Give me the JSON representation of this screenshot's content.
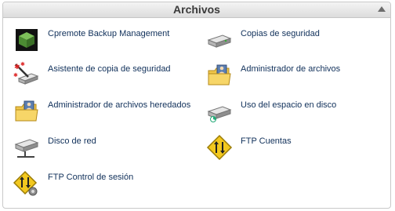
{
  "panel": {
    "title": "Archivos"
  },
  "items": [
    {
      "label": "Cpremote Backup Management",
      "icon": "cpremote-backup-icon"
    },
    {
      "label": "Copias de seguridad",
      "icon": "backup-drive-icon"
    },
    {
      "label": "Asistente de copia de seguridad",
      "icon": "backup-wizard-icon"
    },
    {
      "label": "Administrador de archivos",
      "icon": "file-manager-folder-icon"
    },
    {
      "label": "Administrador de archivos heredados",
      "icon": "legacy-file-manager-folder-icon"
    },
    {
      "label": "Uso del espacio en disco",
      "icon": "disk-usage-icon"
    },
    {
      "label": "Disco de red",
      "icon": "network-disk-icon"
    },
    {
      "label": "FTP Cuentas",
      "icon": "ftp-accounts-sign-icon"
    },
    {
      "label": "FTP Control de sesión",
      "icon": "ftp-session-control-sign-icon"
    }
  ]
}
